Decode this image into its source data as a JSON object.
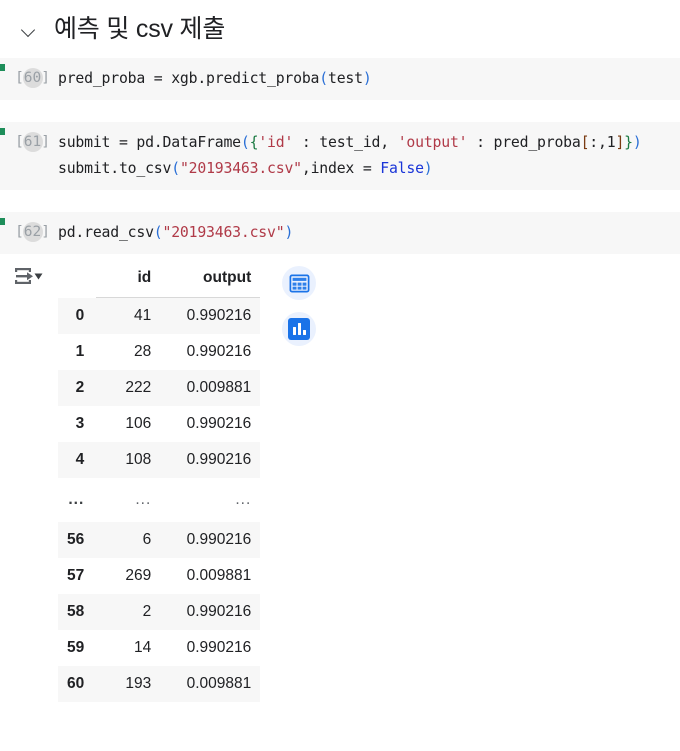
{
  "section": {
    "title": "예측 및 csv 제출",
    "collapse_icon": "chevron-down-icon"
  },
  "cells": [
    {
      "prompt": "[60]",
      "exec_count": "60",
      "lines": [
        [
          {
            "t": "pred_proba = xgb.predict_proba",
            "c": "plain"
          },
          {
            "t": "(",
            "c": "paren"
          },
          {
            "t": "test",
            "c": "plain"
          },
          {
            "t": ")",
            "c": "paren"
          }
        ]
      ]
    },
    {
      "prompt": "[61]",
      "exec_count": "61",
      "lines": [
        [
          {
            "t": "submit = pd.DataFrame",
            "c": "plain"
          },
          {
            "t": "(",
            "c": "paren"
          },
          {
            "t": "{",
            "c": "brace"
          },
          {
            "t": "'id'",
            "c": "str"
          },
          {
            "t": " : test_id, ",
            "c": "plain"
          },
          {
            "t": "'output'",
            "c": "str"
          },
          {
            "t": " : pred_proba",
            "c": "plain"
          },
          {
            "t": "[",
            "c": "brack"
          },
          {
            "t": ":,1",
            "c": "plain"
          },
          {
            "t": "]",
            "c": "brack"
          },
          {
            "t": "}",
            "c": "brace"
          },
          {
            "t": ")",
            "c": "paren"
          }
        ],
        [
          {
            "t": "submit.to_csv",
            "c": "plain"
          },
          {
            "t": "(",
            "c": "paren"
          },
          {
            "t": "\"20193463.csv\"",
            "c": "str"
          },
          {
            "t": ",index = ",
            "c": "plain"
          },
          {
            "t": "False",
            "c": "kw"
          },
          {
            "t": ")",
            "c": "paren"
          }
        ]
      ]
    },
    {
      "prompt": "[62]",
      "exec_count": "62",
      "lines": [
        [
          {
            "t": "pd.read_csv",
            "c": "plain"
          },
          {
            "t": "(",
            "c": "paren"
          },
          {
            "t": "\"20193463.csv\"",
            "c": "str"
          },
          {
            "t": ")",
            "c": "paren"
          }
        ]
      ]
    }
  ],
  "output": {
    "output_type_icon": "output-transform-icon",
    "actions": [
      {
        "name": "view-as-table-button",
        "icon": "table-grid-icon"
      },
      {
        "name": "view-as-chart-button",
        "icon": "bar-chart-icon"
      }
    ],
    "dataframe": {
      "index_header": "",
      "columns": [
        "id",
        "output"
      ],
      "rows": [
        {
          "index": "0",
          "id": "41",
          "output": "0.990216"
        },
        {
          "index": "1",
          "id": "28",
          "output": "0.990216"
        },
        {
          "index": "2",
          "id": "222",
          "output": "0.009881"
        },
        {
          "index": "3",
          "id": "106",
          "output": "0.990216"
        },
        {
          "index": "4",
          "id": "108",
          "output": "0.990216"
        },
        {
          "index": "...",
          "id": "...",
          "output": "...",
          "ellipsis": true
        },
        {
          "index": "56",
          "id": "6",
          "output": "0.990216"
        },
        {
          "index": "57",
          "id": "269",
          "output": "0.009881"
        },
        {
          "index": "58",
          "id": "2",
          "output": "0.990216"
        },
        {
          "index": "59",
          "id": "14",
          "output": "0.990216"
        },
        {
          "index": "60",
          "id": "193",
          "output": "0.009881"
        }
      ]
    }
  },
  "colors": {
    "cell_bg": "#f7f7f7",
    "string": "#b03a48",
    "keyword": "#1a35d8",
    "paren": "#2a6fd6",
    "brace": "#1a7a42",
    "bracket": "#7a3b12",
    "accent_blue": "#1a73e8",
    "accent_blue_bg": "#eaf1fe"
  }
}
